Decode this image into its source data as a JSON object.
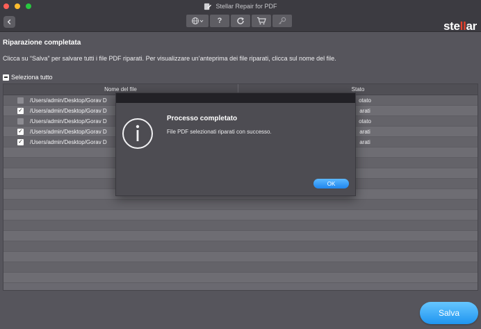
{
  "window": {
    "title": "Stellar Repair for PDF"
  },
  "toolbar": {
    "help_label": "?",
    "logo": "stellar"
  },
  "main": {
    "heading": "Riparazione completata",
    "instructions": "Clicca su “Salva” per salvare tutti i file PDF riparati. Per visualizzare un’anteprima dei file riparati, clicca sul nome del file.",
    "select_all_label": "Seleziona tutto",
    "save_label": "Salva"
  },
  "table": {
    "columns": [
      "Nome del file",
      "Stato"
    ],
    "rows": [
      {
        "checked": false,
        "name": "/Users/admin/Desktop/Gorav D",
        "status": "otato"
      },
      {
        "checked": true,
        "name": "/Users/admin/Desktop/Gorav D",
        "status": "arati"
      },
      {
        "checked": false,
        "name": "/Users/admin/Desktop/Gorav D",
        "status": "otato"
      },
      {
        "checked": true,
        "name": "/Users/admin/Desktop/Gorav D",
        "status": "arati"
      },
      {
        "checked": true,
        "name": "/Users/admin/Desktop/Gorav D",
        "status": "arati"
      }
    ]
  },
  "dialog": {
    "title": "Processo completato",
    "message": "File PDF selezionati riparati con successo.",
    "ok_label": "OK"
  },
  "colors": {
    "accent": "#1f95f0",
    "logo_accent": "#e8412c",
    "background": "#56555c"
  },
  "icons": {
    "back": "chevron-left-icon",
    "language": "globe-icon",
    "help": "question-icon",
    "refresh": "refresh-icon",
    "cart": "cart-icon",
    "activate": "key-icon",
    "dialog": "info-icon"
  }
}
